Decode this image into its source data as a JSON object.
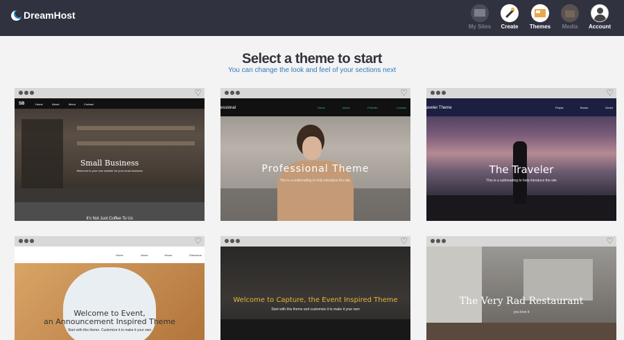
{
  "header": {
    "logo_text": "DreamHost",
    "nav": [
      {
        "label": "My Sites",
        "icon": "monitor-icon",
        "active": false
      },
      {
        "label": "Create",
        "icon": "magic-wand-icon",
        "active": true
      },
      {
        "label": "Themes",
        "icon": "themes-icon",
        "active": true
      },
      {
        "label": "Media",
        "icon": "folder-icon",
        "active": false
      },
      {
        "label": "Account",
        "icon": "user-icon",
        "active": true
      }
    ]
  },
  "page": {
    "title": "Select a theme to start",
    "subtitle": "You can change the look and feel of your sections next"
  },
  "themes": [
    {
      "name": "Small Business",
      "subheading": "Welcome to your new website for your small business",
      "brand": "SB",
      "nav": [
        "Home",
        "About",
        "Menu",
        "Contact"
      ],
      "footer": "It's Not Just Coffee To Us"
    },
    {
      "name": "Professional Theme",
      "subheading": "This is a subheading to help introduce the site.",
      "brand": "essional",
      "nav": [
        "Home",
        "About",
        "Portfolio",
        "Contact"
      ]
    },
    {
      "name": "The Traveler",
      "subheading": "This is a subheading to help introduce the site",
      "brand": "aveler Theme",
      "nav": [
        "Purple",
        "Brown",
        "Green"
      ]
    },
    {
      "name": "Welcome to Event,",
      "name_line2": "an Announcement Inspired Theme",
      "subheading": "Start with this theme. Customize it to make it your own",
      "nav": [
        "Home",
        "About",
        "Venue",
        "Directions"
      ]
    },
    {
      "name": "Welcome to Capture, the Event Inspired Theme",
      "subheading": "Start with this theme and customize it to make it your own"
    },
    {
      "name": "The Very Rad Restaurant",
      "subheading": "you love it"
    }
  ],
  "colors": {
    "header_bg": "#30323f",
    "accent_blue": "#2f7bbd",
    "professional_nav_green": "#2fbf8a",
    "capture_title_gold": "#e6b53a"
  }
}
